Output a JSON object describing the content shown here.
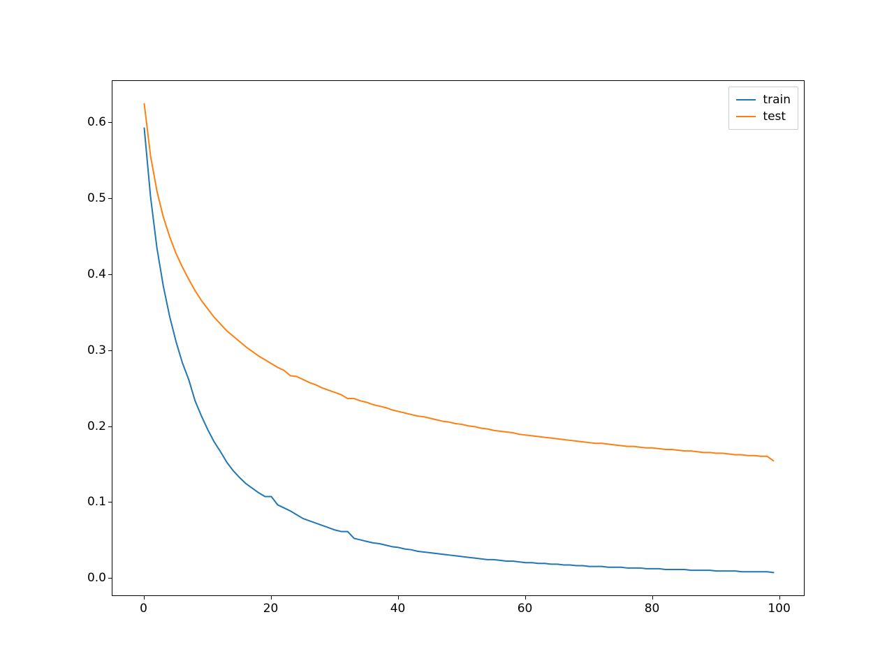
{
  "chart_data": {
    "type": "line",
    "title": "",
    "xlabel": "",
    "ylabel": "",
    "xlim": [
      -5,
      104
    ],
    "ylim": [
      -0.024,
      0.655
    ],
    "x_ticks": [
      0,
      20,
      40,
      60,
      80,
      100
    ],
    "y_ticks": [
      0.0,
      0.1,
      0.2,
      0.3,
      0.4,
      0.5,
      0.6
    ],
    "x": [
      0,
      1,
      2,
      3,
      4,
      5,
      6,
      7,
      8,
      9,
      10,
      11,
      12,
      13,
      14,
      15,
      16,
      17,
      18,
      19,
      20,
      21,
      22,
      23,
      24,
      25,
      26,
      27,
      28,
      29,
      30,
      31,
      32,
      33,
      34,
      35,
      36,
      37,
      38,
      39,
      40,
      41,
      42,
      43,
      44,
      45,
      46,
      47,
      48,
      49,
      50,
      51,
      52,
      53,
      54,
      55,
      56,
      57,
      58,
      59,
      60,
      61,
      62,
      63,
      64,
      65,
      66,
      67,
      68,
      69,
      70,
      71,
      72,
      73,
      74,
      75,
      76,
      77,
      78,
      79,
      80,
      81,
      82,
      83,
      84,
      85,
      86,
      87,
      88,
      89,
      90,
      91,
      92,
      93,
      94,
      95,
      96,
      97,
      98,
      99
    ],
    "series": [
      {
        "name": "train",
        "color": "#1f77b4",
        "values": [
          0.593,
          0.502,
          0.435,
          0.385,
          0.345,
          0.312,
          0.284,
          0.262,
          0.234,
          0.214,
          0.196,
          0.18,
          0.167,
          0.153,
          0.142,
          0.133,
          0.125,
          0.119,
          0.113,
          0.108,
          0.108,
          0.097,
          0.093,
          0.089,
          0.084,
          0.079,
          0.076,
          0.073,
          0.07,
          0.067,
          0.064,
          0.062,
          0.062,
          0.053,
          0.051,
          0.049,
          0.047,
          0.046,
          0.044,
          0.042,
          0.041,
          0.039,
          0.038,
          0.036,
          0.035,
          0.034,
          0.033,
          0.032,
          0.031,
          0.03,
          0.029,
          0.028,
          0.027,
          0.026,
          0.025,
          0.025,
          0.024,
          0.023,
          0.023,
          0.022,
          0.021,
          0.021,
          0.02,
          0.02,
          0.019,
          0.019,
          0.018,
          0.018,
          0.017,
          0.017,
          0.016,
          0.016,
          0.016,
          0.015,
          0.015,
          0.015,
          0.014,
          0.014,
          0.014,
          0.013,
          0.013,
          0.013,
          0.012,
          0.012,
          0.012,
          0.012,
          0.011,
          0.011,
          0.011,
          0.011,
          0.01,
          0.01,
          0.01,
          0.01,
          0.009,
          0.009,
          0.009,
          0.009,
          0.009,
          0.008
        ]
      },
      {
        "name": "test",
        "color": "#ff7f0e",
        "values": [
          0.625,
          0.556,
          0.51,
          0.476,
          0.45,
          0.428,
          0.41,
          0.394,
          0.379,
          0.366,
          0.355,
          0.344,
          0.335,
          0.326,
          0.319,
          0.312,
          0.305,
          0.299,
          0.293,
          0.288,
          0.283,
          0.278,
          0.274,
          0.267,
          0.266,
          0.262,
          0.258,
          0.255,
          0.251,
          0.248,
          0.245,
          0.242,
          0.237,
          0.237,
          0.234,
          0.232,
          0.229,
          0.227,
          0.225,
          0.222,
          0.22,
          0.218,
          0.216,
          0.214,
          0.213,
          0.211,
          0.209,
          0.207,
          0.206,
          0.204,
          0.203,
          0.201,
          0.2,
          0.198,
          0.197,
          0.195,
          0.194,
          0.193,
          0.192,
          0.19,
          0.189,
          0.188,
          0.187,
          0.186,
          0.185,
          0.184,
          0.183,
          0.182,
          0.181,
          0.18,
          0.179,
          0.178,
          0.178,
          0.177,
          0.176,
          0.175,
          0.174,
          0.174,
          0.173,
          0.172,
          0.172,
          0.171,
          0.17,
          0.17,
          0.169,
          0.168,
          0.168,
          0.167,
          0.166,
          0.166,
          0.165,
          0.165,
          0.164,
          0.163,
          0.163,
          0.162,
          0.162,
          0.161,
          0.161,
          0.155
        ]
      }
    ],
    "legend": {
      "position": "upper right"
    }
  },
  "x_tick_labels": [
    "0",
    "20",
    "40",
    "60",
    "80",
    "100"
  ],
  "y_tick_labels": [
    "0.0",
    "0.1",
    "0.2",
    "0.3",
    "0.4",
    "0.5",
    "0.6"
  ],
  "legend_labels": {
    "train": "train",
    "test": "test"
  }
}
